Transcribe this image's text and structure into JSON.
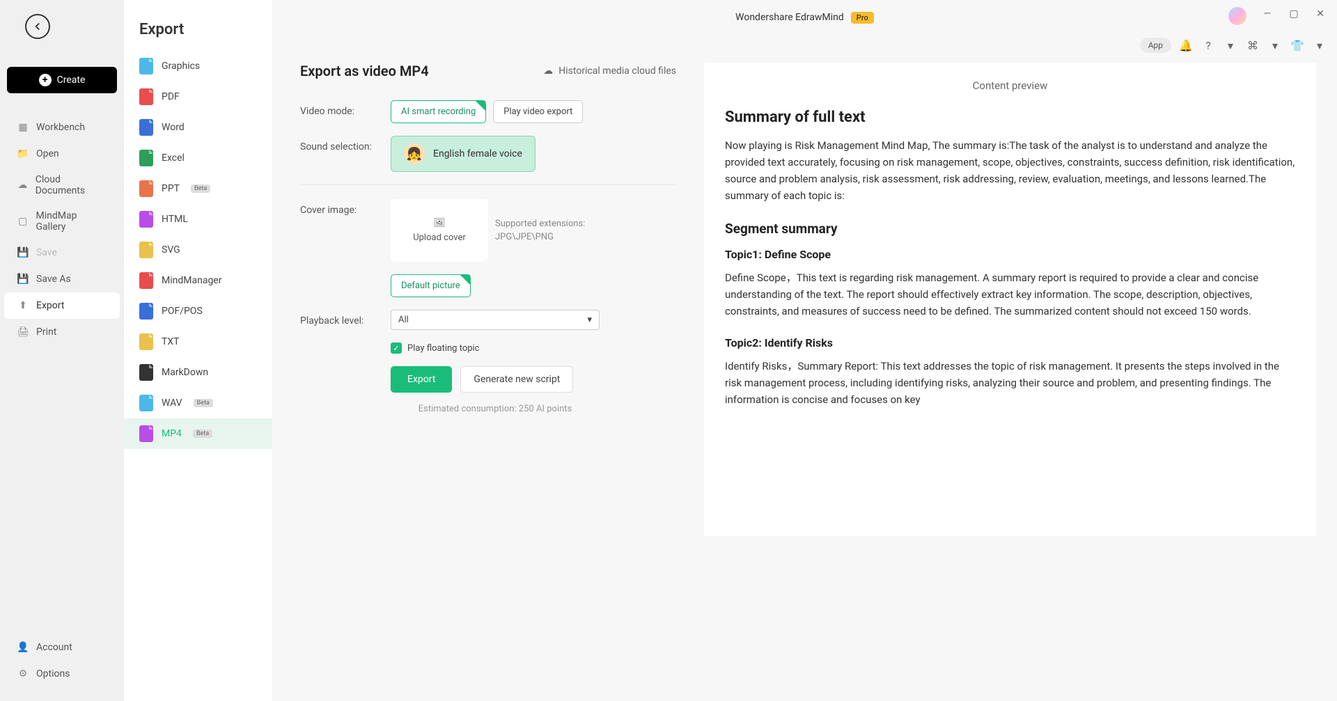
{
  "titlebar": {
    "app_name": "Wondershare EdrawMind",
    "pro": "Pro"
  },
  "toolbar": {
    "app_chip": "App"
  },
  "sidebar": {
    "create": "Create",
    "items": [
      {
        "label": "Workbench"
      },
      {
        "label": "Open"
      },
      {
        "label": "Cloud Documents"
      },
      {
        "label": "MindMap Gallery"
      },
      {
        "label": "Save"
      },
      {
        "label": "Save As"
      },
      {
        "label": "Export"
      },
      {
        "label": "Print"
      }
    ],
    "bottom": [
      {
        "label": "Account"
      },
      {
        "label": "Options"
      }
    ]
  },
  "export_col": {
    "title": "Export",
    "items": [
      {
        "label": "Graphics",
        "color": "#4db8e8"
      },
      {
        "label": "PDF",
        "color": "#e84d4d"
      },
      {
        "label": "Word",
        "color": "#3a6fd8"
      },
      {
        "label": "Excel",
        "color": "#2e9e5b"
      },
      {
        "label": "PPT",
        "color": "#e8734d",
        "beta": true
      },
      {
        "label": "HTML",
        "color": "#b84de8"
      },
      {
        "label": "SVG",
        "color": "#e8c24d"
      },
      {
        "label": "MindManager",
        "color": "#e84d4d"
      },
      {
        "label": "POF/POS",
        "color": "#3a6fd8"
      },
      {
        "label": "TXT",
        "color": "#e8c24d"
      },
      {
        "label": "MarkDown",
        "color": "#333333"
      },
      {
        "label": "WAV",
        "color": "#4db8e8",
        "beta": true
      },
      {
        "label": "MP4",
        "color": "#b84de8",
        "beta": true
      }
    ]
  },
  "form": {
    "title": "Export as video MP4",
    "history_link": "Historical media cloud files",
    "video_mode_label": "Video mode:",
    "video_mode_opts": [
      "AI smart recording",
      "Play video export"
    ],
    "sound_label": "Sound selection:",
    "voice_name": "English female voice",
    "cover_label": "Cover image:",
    "upload_text": "Upload cover",
    "ext_label": "Supported extensions:",
    "ext_value": "JPG\\JPE\\PNG",
    "default_pic": "Default picture",
    "playback_label": "Playback level:",
    "playback_value": "All",
    "play_floating": "Play floating topic",
    "export_btn": "Export",
    "generate_btn": "Generate new script",
    "estimate": "Estimated consumption: 250 AI points"
  },
  "preview": {
    "title": "Content preview",
    "h1": "Summary of full text",
    "p1": "Now playing is Risk Management Mind Map, The summary is:The task of the analyst is to understand and analyze the provided text accurately, focusing on risk management, scope, objectives, constraints, success definition, risk identification, source and problem analysis, risk assessment, risk addressing, review, evaluation, meetings, and lessons learned.The summary of each topic is:",
    "h2": "Segment summary",
    "t1h": "Topic1: Define Scope",
    "t1p": "Define Scope，This text is regarding risk management. A summary report is required to provide a clear and concise understanding of the text. The report should effectively extract key information. The scope, description, objectives, constraints, and measures of success need to be defined. The summarized content should not exceed 150 words.",
    "t2h": "Topic2: Identify Risks",
    "t2p": "Identify Risks，Summary Report: This text addresses the topic of risk management. It presents the steps involved in the risk management process, including identifying risks, analyzing their source and problem, and presenting findings. The information is concise and focuses on key"
  }
}
